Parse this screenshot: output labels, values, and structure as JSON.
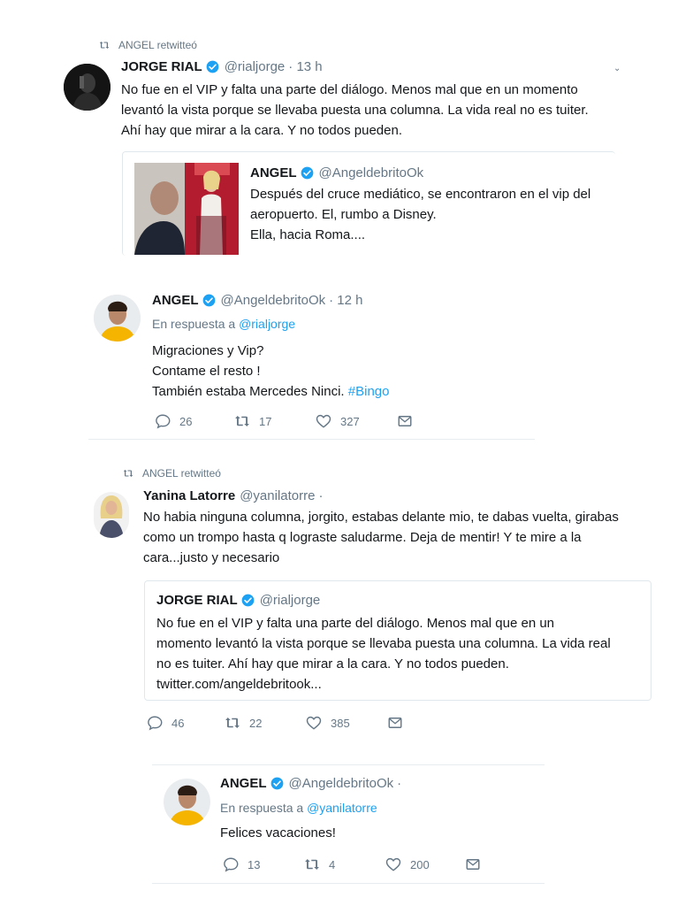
{
  "block1": {
    "retweeted_by": "ANGEL retwitteó",
    "author_name": "JORGE RIAL",
    "author_handle": "@rialjorge",
    "time": "· 13 h",
    "text_lines": [
      "No fue en el VIP y falta una parte del diálogo. Menos mal que en un momento",
      "levantó la vista porque se llevaba puesta una columna. La vida real no es tuiter.",
      "Ahí hay que mirar a la cara. Y no todos pueden."
    ],
    "quoted": {
      "author_name": "ANGEL",
      "author_handle": "@AngeldebritoOk",
      "text_lines": [
        "Después del cruce mediático, se encontraron en el vip del",
        "aeropuerto. El, rumbo a Disney.",
        "Ella, hacia Roma...."
      ]
    }
  },
  "block2": {
    "author_name": "ANGEL",
    "author_handle": "@AngeldebritoOk",
    "time": "· 12 h",
    "reply_prefix": "En respuesta a",
    "reply_handle": "@rialjorge",
    "line1": "Migraciones y Vip?",
    "line2": "Contame el resto !",
    "line3": "También estaba Mercedes Ninci.",
    "hashtag": "#Bingo",
    "replies": "26",
    "retweets": "17",
    "likes": "327"
  },
  "block3": {
    "retweeted_by": "ANGEL retwitteó",
    "author_name": "Yanina Latorre",
    "author_handle": "@yanilatorre",
    "time": "·",
    "text_lines": [
      "No habia ninguna columna, jorgito, estabas delante mio, te dabas vuelta, girabas",
      "como un trompo hasta q lograste saludarme. Deja de mentir! Y te mire a la",
      "cara...justo y necesario"
    ],
    "quoted": {
      "author_name": "JORGE RIAL",
      "author_handle": "@rialjorge",
      "text_lines": [
        "No fue en el VIP y falta una parte del diálogo. Menos mal que en un",
        "momento levantó la vista porque se llevaba puesta una columna. La vida real",
        "no es tuiter. Ahí hay que mirar a la cara. Y no todos pueden.",
        "twitter.com/angeldebritook..."
      ]
    },
    "replies": "46",
    "retweets": "22",
    "likes": "385"
  },
  "block4": {
    "author_name": "ANGEL",
    "author_handle": "@AngeldebritoOk",
    "time": "·",
    "reply_prefix": "En respuesta a",
    "reply_handle": "@yanilatorre",
    "text": "Felices vacaciones!",
    "replies": "13",
    "retweets": "4",
    "likes": "200"
  },
  "colors": {
    "accent": "#1da1f2",
    "muted": "#657786",
    "text": "#14171a",
    "border": "#e1e8ed"
  },
  "icons": [
    "retweet-icon",
    "verified-badge-icon",
    "reply-icon",
    "heart-icon",
    "mail-icon",
    "chevron-down-icon"
  ]
}
